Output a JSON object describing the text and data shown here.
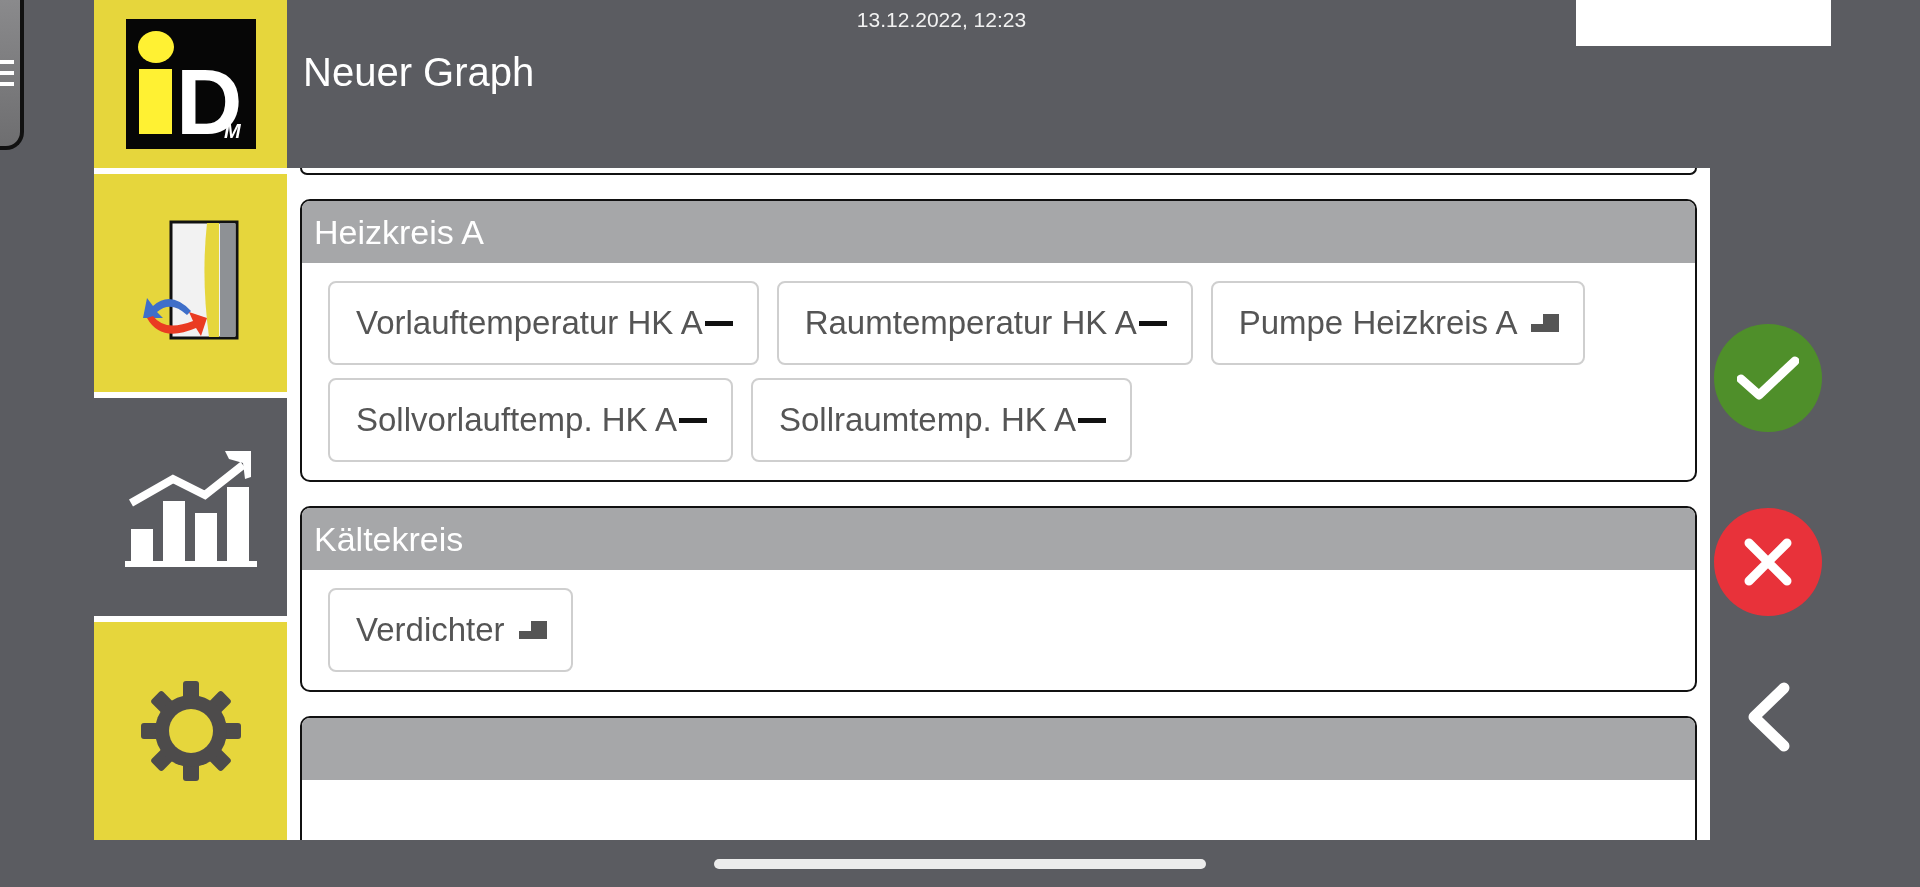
{
  "header": {
    "timestamp": "13.12.2022, 12:23",
    "title": "Neuer Graph"
  },
  "logo": {
    "letter": "D",
    "subscript": "M"
  },
  "sidebar": {
    "items": [
      {
        "kind": "logo",
        "selected": false
      },
      {
        "kind": "system",
        "selected": false
      },
      {
        "kind": "graph",
        "selected": true
      },
      {
        "kind": "settings",
        "selected": false
      }
    ]
  },
  "groups": [
    {
      "title": "Heizkreis A",
      "signals": [
        {
          "label": "Vorlauftemperatur HK A",
          "kind": "analog"
        },
        {
          "label": "Raumtemperatur HK A",
          "kind": "analog"
        },
        {
          "label": "Pumpe Heizkreis A",
          "kind": "digital"
        },
        {
          "label": "Sollvorlauftemp. HK A",
          "kind": "analog"
        },
        {
          "label": "Sollraumtemp. HK A",
          "kind": "analog"
        }
      ]
    },
    {
      "title": "Kältekreis",
      "signals": [
        {
          "label": "Verdichter",
          "kind": "digital"
        }
      ]
    }
  ]
}
